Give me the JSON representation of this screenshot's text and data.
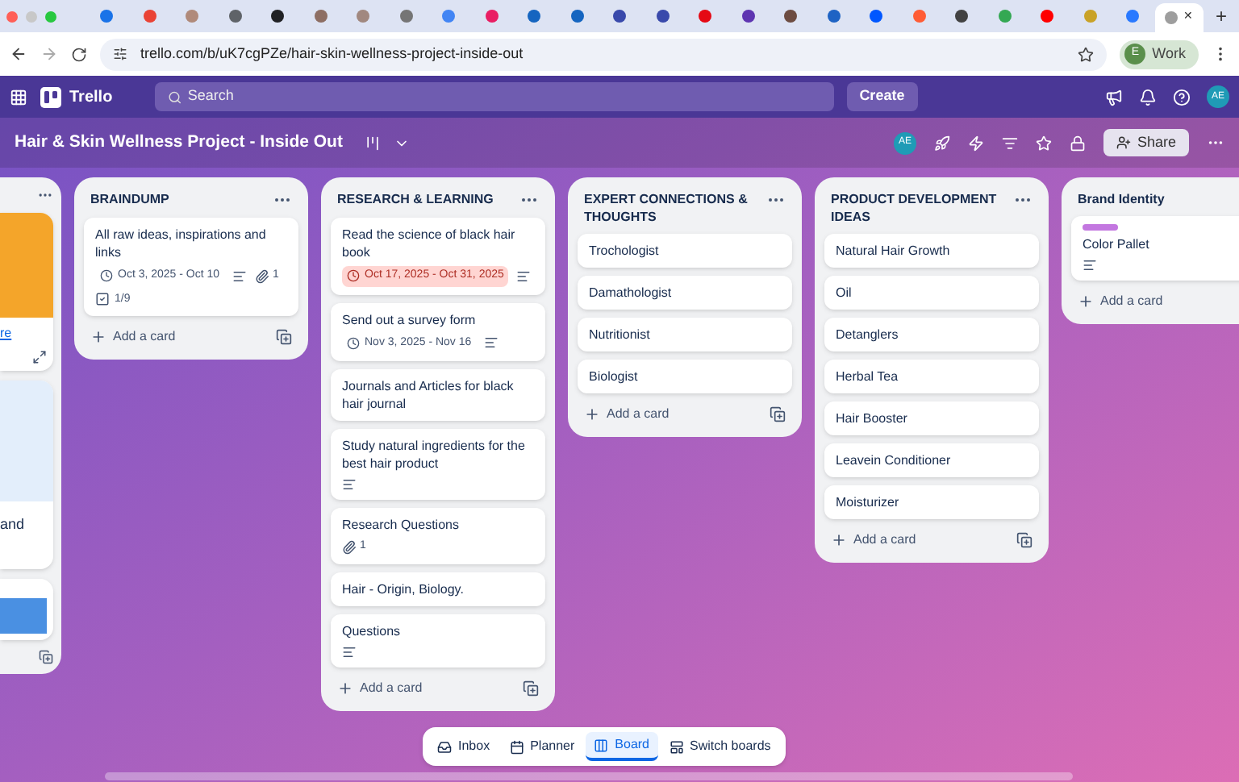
{
  "browser": {
    "tabs": [
      {
        "selected": false,
        "color": "#1a73e8"
      },
      {
        "selected": false,
        "color": "#ea4335"
      },
      {
        "selected": false,
        "color": "#b08a7a"
      },
      {
        "selected": false,
        "color": "#5f6368"
      },
      {
        "selected": false,
        "color": "#202124"
      },
      {
        "selected": false,
        "color": "#8d6e63"
      },
      {
        "selected": false,
        "color": "#a1887f"
      },
      {
        "selected": false,
        "color": "#757575"
      },
      {
        "selected": false,
        "color": "#4285f4"
      },
      {
        "selected": false,
        "color": "#e91e63"
      },
      {
        "selected": false,
        "color": "#1565c0"
      },
      {
        "selected": false,
        "color": "#1565c0"
      },
      {
        "selected": false,
        "color": "#3949ab"
      },
      {
        "selected": false,
        "color": "#3949ab"
      },
      {
        "selected": false,
        "color": "#e50914"
      },
      {
        "selected": false,
        "color": "#5e35b1"
      },
      {
        "selected": false,
        "color": "#6d4c41"
      },
      {
        "selected": false,
        "color": "#1e63c4"
      },
      {
        "selected": false,
        "color": "#0057ff"
      },
      {
        "selected": false,
        "color": "#ff5c35"
      },
      {
        "selected": false,
        "color": "#424242"
      },
      {
        "selected": false,
        "color": "#34a853"
      },
      {
        "selected": false,
        "color": "#ff0000"
      },
      {
        "selected": false,
        "color": "#c9a227"
      },
      {
        "selected": false,
        "color": "#2979ff"
      },
      {
        "selected": true,
        "color": "#9e9e9e"
      }
    ],
    "close_tab": "✕",
    "new_tab": "+",
    "url": "trello.com/b/uK7cgPZe/hair-skin-wellness-project-inside-out",
    "profile": {
      "initial": "E",
      "name": "Work"
    }
  },
  "app_header": {
    "logo": "Trello",
    "search": {
      "placeholder": "Search"
    },
    "create": "Create",
    "avatar": "AE"
  },
  "board": {
    "title": "Hair & Skin Wellness Project - Inside Out",
    "avatar": "AE",
    "share": "Share"
  },
  "partial_list": {
    "link": "re",
    "text": "and"
  },
  "lists": [
    {
      "title": "BRAINDUMP",
      "menu": true,
      "cards": [
        {
          "title": "All raw ideas, inspirations and links",
          "date": {
            "text": "Oct 3, 2025 - Oct 10",
            "overdue": false
          },
          "description": true,
          "attachments": "1",
          "checklist": "1/9"
        }
      ],
      "add": "Add a card"
    },
    {
      "title": "RESEARCH & LEARNING",
      "menu": true,
      "cards": [
        {
          "title": "Read the science of black hair book",
          "date": {
            "text": "Oct 17, 2025 - Oct 31, 2025",
            "overdue": true
          },
          "description": true
        },
        {
          "title": "Send out a survey form",
          "date": {
            "text": "Nov 3, 2025 - Nov 16",
            "overdue": false
          },
          "description": true
        },
        {
          "title": "Journals and Articles for black hair journal",
          "description": false
        },
        {
          "title": "Study natural ingredients for the best hair product",
          "description": true
        },
        {
          "title": "Research Questions",
          "description": false,
          "attachments": "1"
        },
        {
          "title": "Hair - Origin, Biology.",
          "description": false
        },
        {
          "title": "Questions",
          "description": true
        }
      ],
      "add": "Add a card"
    },
    {
      "title": "EXPERT CONNECTIONS & THOUGHTS",
      "menu": true,
      "cards": [
        {
          "title": "Trochologist",
          "description": false
        },
        {
          "title": "Damathologist",
          "description": false
        },
        {
          "title": "Nutritionist",
          "description": false
        },
        {
          "title": "Biologist",
          "description": false
        }
      ],
      "add": "Add a card"
    },
    {
      "title": "PRODUCT DEVELOPMENT IDEAS",
      "menu": true,
      "cards": [
        {
          "title": "Natural Hair Growth",
          "description": false
        },
        {
          "title": "Oil",
          "description": false
        },
        {
          "title": "Detanglers",
          "description": false
        },
        {
          "title": "Herbal Tea",
          "description": false
        },
        {
          "title": "Hair Booster",
          "description": false
        },
        {
          "title": "Leavein Conditioner",
          "description": false
        },
        {
          "title": "Moisturizer",
          "description": false
        }
      ],
      "add": "Add a card"
    },
    {
      "title": "Brand Identity",
      "menu": false,
      "cards": [
        {
          "title": "Color Pallet",
          "description": true,
          "label": {
            "color": "#c377e0"
          }
        }
      ],
      "add": "Add a card"
    }
  ],
  "bottom_nav": [
    {
      "label": "Inbox",
      "kind": "inbox",
      "selected": false
    },
    {
      "label": "Planner",
      "kind": "planner",
      "selected": false
    },
    {
      "label": "Board",
      "kind": "board",
      "selected": true
    },
    {
      "label": "Switch boards",
      "kind": "switch",
      "selected": false
    }
  ]
}
